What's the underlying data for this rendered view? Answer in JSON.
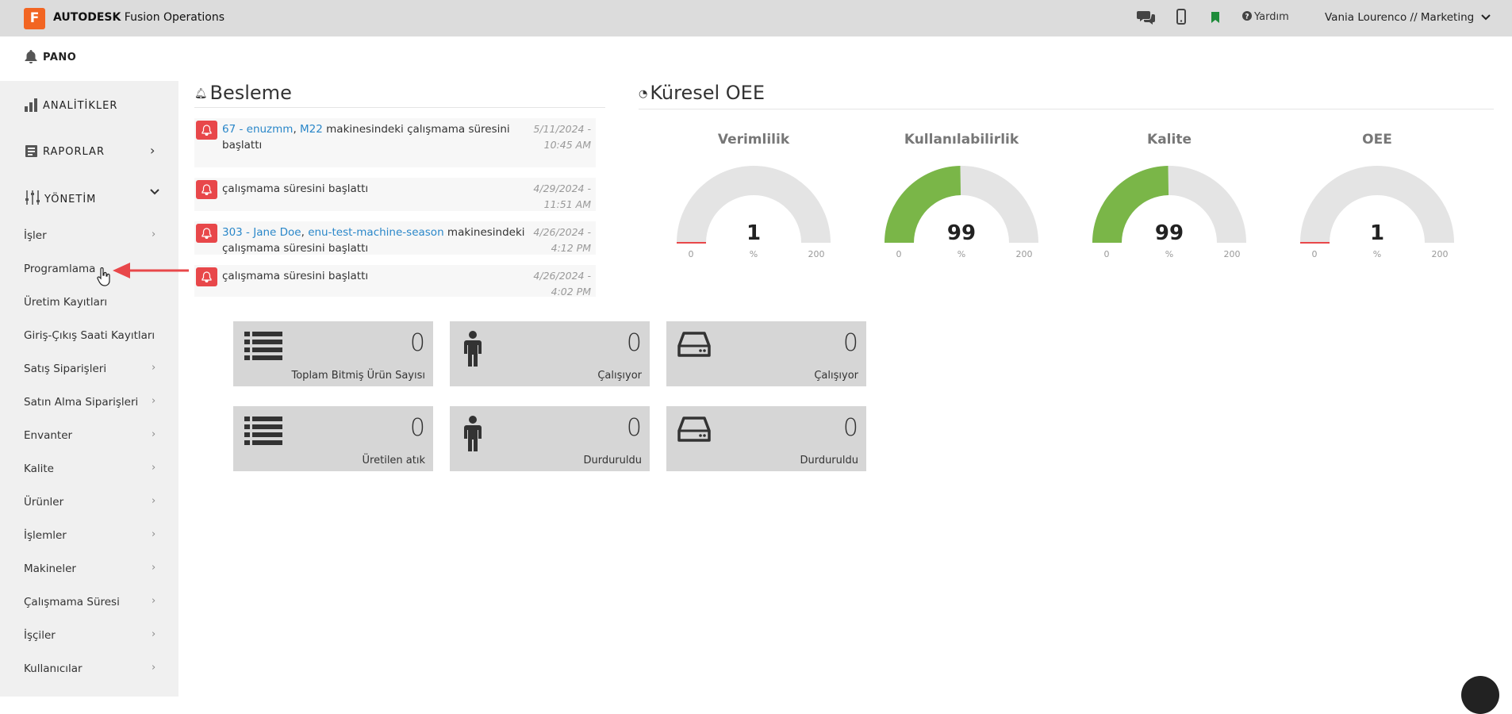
{
  "header": {
    "logo_letter": "F",
    "brand_bold": "AUTODESK",
    "brand_rest": "Fusion Operations",
    "help_label": "Yardım",
    "user_label": "Vania Lourenco // Marketing",
    "icons": [
      "chat-icon",
      "mobile-icon",
      "bookmark-icon",
      "help-icon",
      "chevron-down-icon"
    ]
  },
  "pano": {
    "label": "PANO"
  },
  "sidebar": {
    "sections": [
      {
        "label": "ANALİTİKLER",
        "icon": "bar-chart-icon"
      },
      {
        "label": "RAPORLAR",
        "icon": "report-icon",
        "chevron": "›"
      },
      {
        "label": "YÖNETİM",
        "icon": "sliders-icon",
        "chevron": "⌄"
      }
    ],
    "items": [
      {
        "label": "İşler",
        "arrow": "›"
      },
      {
        "label": "Programlama",
        "arrow": ""
      },
      {
        "label": "Üretim Kayıtları",
        "arrow": ""
      },
      {
        "label": "Giriş-Çıkış Saati Kayıtları",
        "arrow": ""
      },
      {
        "label": "Satış Siparişleri",
        "arrow": "›"
      },
      {
        "label": "Satın Alma Siparişleri",
        "arrow": "›"
      },
      {
        "label": "Envanter",
        "arrow": "›"
      },
      {
        "label": "Kalite",
        "arrow": "›"
      },
      {
        "label": "Ürünler",
        "arrow": "›"
      },
      {
        "label": "İşlemler",
        "arrow": "›"
      },
      {
        "label": "Makineler",
        "arrow": "›"
      },
      {
        "label": "Çalışmama Süresi",
        "arrow": "›"
      },
      {
        "label": "İşçiler",
        "arrow": "›"
      },
      {
        "label": "Kullanıcılar",
        "arrow": "›"
      }
    ]
  },
  "feed": {
    "title": "Besleme",
    "items": [
      {
        "link1": "67 - enuzmm",
        "sep": ", ",
        "link2": "M22",
        "text": " makinesindeki çalışmama süresini başlattı",
        "time": "5/11/2024 - 10:45 AM"
      },
      {
        "link1": "",
        "sep": "",
        "link2": "",
        "text": "çalışmama süresini başlattı",
        "time": "4/29/2024 - 11:51 AM"
      },
      {
        "link1": "303 - Jane Doe",
        "sep": ", ",
        "link2": "enu-test-machine-season",
        "text": " makinesindeki çalışmama süresini başlattı",
        "time": "4/26/2024 - 4:12 PM"
      },
      {
        "link1": "",
        "sep": "",
        "link2": "",
        "text": "çalışmama süresini başlattı",
        "time": "4/26/2024 - 4:02 PM"
      }
    ]
  },
  "oee": {
    "title": "Küresel OEE",
    "gauges": [
      {
        "label": "Verimlilik",
        "value": 1,
        "display": "1",
        "unit": "%",
        "min": "0",
        "max": "200",
        "color": "#e8474a"
      },
      {
        "label": "Kullanılabilirlik",
        "value": 99,
        "display": "99",
        "unit": "%",
        "min": "0",
        "max": "200",
        "color": "#7ab648"
      },
      {
        "label": "Kalite",
        "value": 99,
        "display": "99",
        "unit": "%",
        "min": "0",
        "max": "200",
        "color": "#7ab648"
      },
      {
        "label": "OEE",
        "value": 1,
        "display": "1",
        "unit": "%",
        "min": "0",
        "max": "200",
        "color": "#e8474a"
      }
    ]
  },
  "tiles": [
    {
      "icon": "list-icon",
      "value": "0",
      "label": "Toplam Bitmiş Ürün Sayısı"
    },
    {
      "icon": "person-icon",
      "value": "0",
      "label": "Çalışıyor"
    },
    {
      "icon": "drive-icon",
      "value": "0",
      "label": "Çalışıyor"
    },
    {
      "icon": "list-icon",
      "value": "0",
      "label": "Üretilen atık"
    },
    {
      "icon": "person-icon",
      "value": "0",
      "label": "Durduruldu"
    },
    {
      "icon": "drive-icon",
      "value": "0",
      "label": "Durduruldu"
    }
  ],
  "colors": {
    "accent": "#f26522",
    "link": "#2a87c9",
    "badge": "#e8474a",
    "gauge_fill": "#7ab648",
    "gauge_track": "#e4e4e4"
  }
}
